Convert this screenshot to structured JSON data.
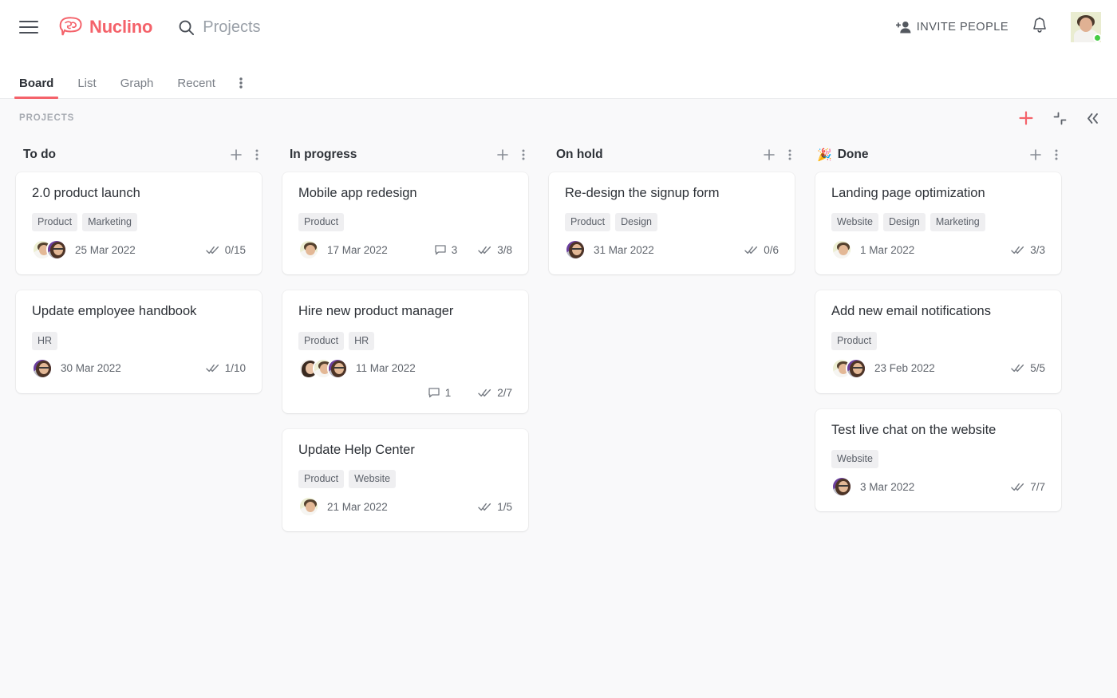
{
  "app": {
    "brand": "Nuclino",
    "brand_color": "#f4626a"
  },
  "topbar": {
    "menu_icon": "hamburger-icon",
    "search_icon": "search-icon",
    "search_placeholder": "Projects",
    "search_value": "Projects",
    "invite_label": "INVITE PEOPLE",
    "invite_icon": "person-add-icon",
    "notifications_icon": "bell-icon",
    "avatar_icon": "user-avatar",
    "status": "online"
  },
  "tabs": [
    {
      "label": "Board",
      "active": true
    },
    {
      "label": "List",
      "active": false
    },
    {
      "label": "Graph",
      "active": false
    },
    {
      "label": "Recent",
      "active": false
    }
  ],
  "tabs_more_icon": "more-vertical-icon",
  "board": {
    "title": "PROJECTS",
    "actions": [
      {
        "name": "add-item-button",
        "icon": "plus-icon",
        "color": "#f4626a"
      },
      {
        "name": "collapse-all-button",
        "icon": "collapse-icon",
        "color": "#63686f"
      },
      {
        "name": "hide-sidebar-button",
        "icon": "chevrons-left-icon",
        "color": "#63686f"
      }
    ]
  },
  "columns": [
    {
      "name": "To do",
      "emoji": "",
      "add_icon": "plus-icon",
      "more_icon": "more-vertical-icon",
      "cards": [
        {
          "title": "2.0 product launch",
          "tags": [
            "Product",
            "Marketing"
          ],
          "avatars": [
            "man-cream",
            "woman-purple"
          ],
          "date": "25 Mar 2022",
          "comments": null,
          "tasks": "0/15",
          "wrap": false
        },
        {
          "title": "Update employee handbook",
          "tags": [
            "HR"
          ],
          "avatars": [
            "woman-purple"
          ],
          "date": "30 Mar 2022",
          "comments": null,
          "tasks": "1/10",
          "wrap": false
        }
      ]
    },
    {
      "name": "In progress",
      "emoji": "",
      "add_icon": "plus-icon",
      "more_icon": "more-vertical-icon",
      "cards": [
        {
          "title": "Mobile app redesign",
          "tags": [
            "Product"
          ],
          "avatars": [
            "man-cream"
          ],
          "date": "17 Mar 2022",
          "comments": "3",
          "tasks": "3/8",
          "wrap": false
        },
        {
          "title": "Hire new product manager",
          "tags": [
            "Product",
            "HR"
          ],
          "avatars": [
            "woman-dark",
            "man-cream",
            "woman-purple"
          ],
          "date": "11 Mar 2022",
          "comments": "1",
          "tasks": "2/7",
          "wrap": true
        },
        {
          "title": "Update Help Center",
          "tags": [
            "Product",
            "Website"
          ],
          "avatars": [
            "man-cream"
          ],
          "date": "21 Mar 2022",
          "comments": null,
          "tasks": "1/5",
          "wrap": false
        }
      ]
    },
    {
      "name": "On hold",
      "emoji": "",
      "add_icon": "plus-icon",
      "more_icon": "more-vertical-icon",
      "cards": [
        {
          "title": "Re-design the signup form",
          "tags": [
            "Product",
            "Design"
          ],
          "avatars": [
            "woman-purple"
          ],
          "date": "31 Mar 2022",
          "comments": null,
          "tasks": "0/6",
          "wrap": false
        }
      ]
    },
    {
      "name": "Done",
      "emoji": "🎉",
      "add_icon": "plus-icon",
      "more_icon": "more-vertical-icon",
      "cards": [
        {
          "title": "Landing page optimization",
          "tags": [
            "Website",
            "Design",
            "Marketing"
          ],
          "avatars": [
            "man-cream"
          ],
          "date": "1 Mar 2022",
          "comments": null,
          "tasks": "3/3",
          "wrap": false
        },
        {
          "title": "Add new email notifications",
          "tags": [
            "Product"
          ],
          "avatars": [
            "man-cream",
            "woman-purple"
          ],
          "date": "23 Feb 2022",
          "comments": null,
          "tasks": "5/5",
          "wrap": false
        },
        {
          "title": "Test live chat on the website",
          "tags": [
            "Website"
          ],
          "avatars": [
            "woman-purple"
          ],
          "date": "3 Mar 2022",
          "comments": null,
          "tasks": "7/7",
          "wrap": false
        }
      ]
    }
  ],
  "icons": {
    "tasks": "double-check-icon",
    "comments": "comment-icon"
  }
}
